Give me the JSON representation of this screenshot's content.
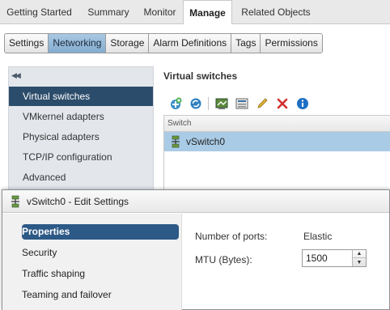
{
  "top_tabs": [
    {
      "label": "Getting Started"
    },
    {
      "label": "Summary"
    },
    {
      "label": "Monitor"
    },
    {
      "label": "Manage",
      "active": true
    },
    {
      "label": "Related Objects"
    }
  ],
  "sub_tabs": [
    {
      "label": "Settings"
    },
    {
      "label": "Networking",
      "active": true
    },
    {
      "label": "Storage"
    },
    {
      "label": "Alarm Definitions"
    },
    {
      "label": "Tags"
    },
    {
      "label": "Permissions"
    }
  ],
  "left_nav": {
    "collapse_icon": "double-chevron-left-icon",
    "items": [
      {
        "label": "Virtual switches",
        "active": true
      },
      {
        "label": "VMkernel adapters"
      },
      {
        "label": "Physical adapters"
      },
      {
        "label": "TCP/IP configuration"
      },
      {
        "label": "Advanced"
      }
    ]
  },
  "main": {
    "title": "Virtual switches",
    "toolbar": [
      "add-networking-icon",
      "refresh-icon",
      "migrate-icon",
      "manage-adapters-icon",
      "edit-icon",
      "remove-icon",
      "info-icon"
    ],
    "table": {
      "header": "Switch",
      "rows": [
        {
          "name": "vSwitch0",
          "icon": "vswitch-icon",
          "selected": true
        }
      ]
    }
  },
  "dialog": {
    "title": "vSwitch0 - Edit Settings",
    "nav": [
      {
        "label": "Properties",
        "active": true
      },
      {
        "label": "Security"
      },
      {
        "label": "Traffic shaping"
      },
      {
        "label": "Teaming and failover"
      }
    ],
    "fields": {
      "ports_label": "Number of ports:",
      "ports_value": "Elastic",
      "mtu_label": "MTU (Bytes):",
      "mtu_value": "1500"
    }
  },
  "colors": {
    "nav_active": "#2c4c6b",
    "row_selected": "#a9cbe6",
    "subtab_active": "#8fb4d6",
    "dialog_nav_active": "#2c5986"
  }
}
